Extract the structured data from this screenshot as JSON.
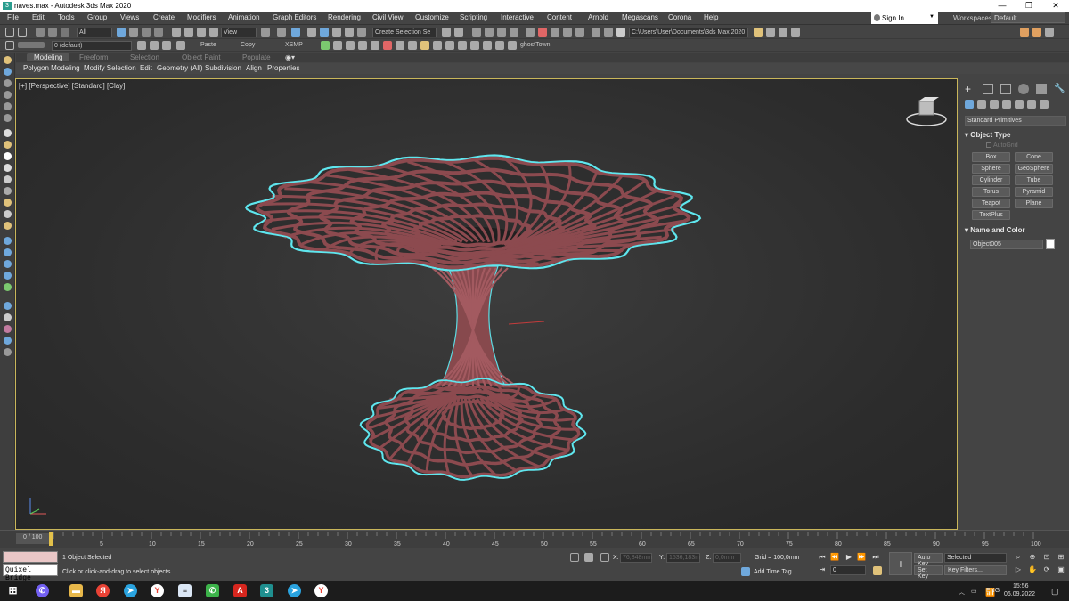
{
  "window": {
    "title": "naves.max - Autodesk 3ds Max 2020",
    "app_icon": "3",
    "minimize": "—",
    "maximize": "❐",
    "close": "✕"
  },
  "menu": [
    "File",
    "Edit",
    "Tools",
    "Group",
    "Views",
    "Create",
    "Modifiers",
    "Animation",
    "Graph Editors",
    "Rendering",
    "Civil View",
    "Customize",
    "Scripting",
    "Interactive",
    "Content",
    "Arnold",
    "Megascans",
    "Corona",
    "Help"
  ],
  "account": {
    "sign_in": "Sign In",
    "workspaces_label": "Workspaces:",
    "workspace": "Default"
  },
  "toolbar1": {
    "selection_filter": "All",
    "view_dropdown": "View",
    "named_selection": "Create Selection Se",
    "project_path": "C:\\Users\\User\\Documents\\3ds Max 2020"
  },
  "toolbar2": {
    "layer": "0 (default)",
    "paste": "Paste",
    "copy": "Copy",
    "xsmp": "XSMP",
    "ghosttown": "ghostTown"
  },
  "ribbon": {
    "tabs": [
      "Modeling",
      "Freeform",
      "Selection",
      "Object Paint",
      "Populate"
    ],
    "active_tab": "Modeling",
    "subitems": [
      "Polygon Modeling",
      "Modify Selection",
      "Edit",
      "Geometry (All)",
      "Subdivision",
      "Align",
      "Properties"
    ]
  },
  "viewport": {
    "label": "[+] [Perspective] [Standard] [Clay]",
    "selection_color": "#5fe6ee",
    "object_color": "#8c4a4f"
  },
  "command_panel": {
    "category": "Standard Primitives",
    "object_type_title": "Object Type",
    "autogrid": "AutoGrid",
    "buttons": [
      "Box",
      "Cone",
      "Sphere",
      "GeoSphere",
      "Cylinder",
      "Tube",
      "Torus",
      "Pyramid",
      "Teapot",
      "Plane",
      "TextPlus"
    ],
    "name_color_title": "Name and Color",
    "object_name": "Object005"
  },
  "timeline": {
    "frame": "0 / 100",
    "ticks": [
      "5",
      "10",
      "15",
      "20",
      "25",
      "30",
      "35",
      "40",
      "45",
      "50",
      "55",
      "60",
      "65",
      "70",
      "75",
      "80",
      "85",
      "90",
      "95",
      "100"
    ]
  },
  "status": {
    "maxscript": "Quixel Bridge",
    "selection_count": "1 Object Selected",
    "prompt": "Click or click-and-drag to select objects",
    "x_label": "X:",
    "x_value": "76,848mm",
    "y_label": "Y:",
    "y_value": "1536,183m",
    "z_label": "Z:",
    "z_value": "0,0mm",
    "grid": "Grid = 100,0mm",
    "add_time_tag": "Add Time Tag",
    "frame_field": "0",
    "auto_key": "Auto Key",
    "set_key": "Set Key",
    "key_filter_select": "Selected",
    "key_filters": "Key Filters..."
  },
  "taskbar": {
    "lang": "ENG",
    "time": "15:56",
    "date": "06.09.2022",
    "apps": [
      "viber",
      "files",
      "yandex-y",
      "telegram",
      "yandex-browser",
      "document",
      "phone",
      "acrobat",
      "3dsmax",
      "telegram-2",
      "yandex-browser-2"
    ]
  }
}
